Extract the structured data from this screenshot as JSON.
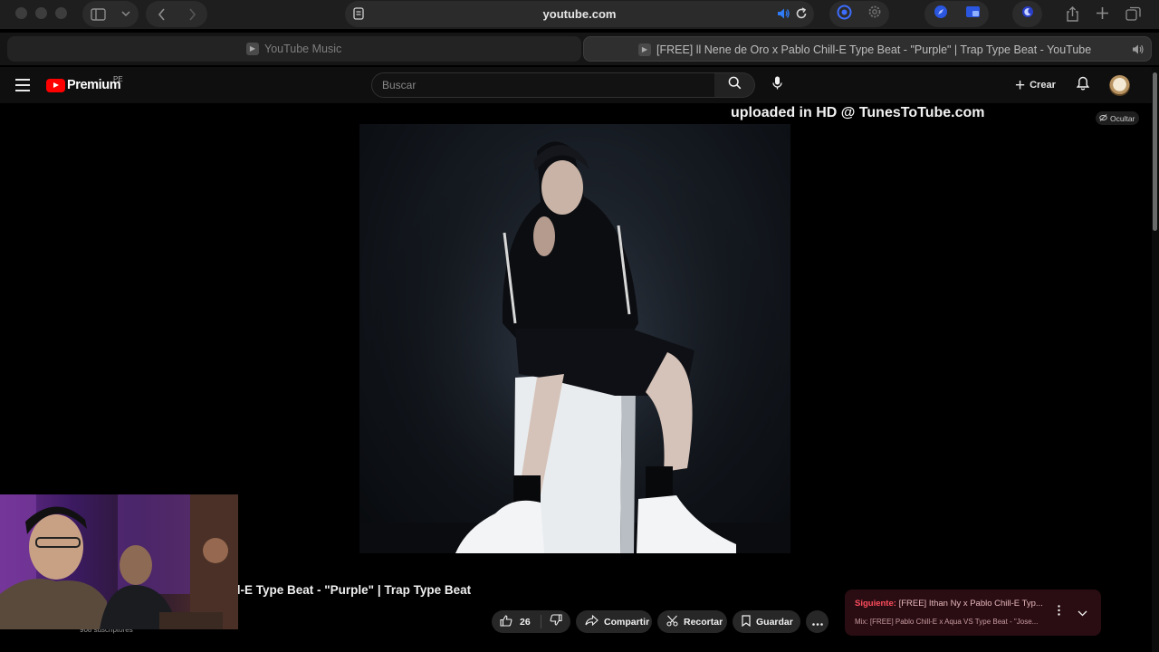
{
  "browser": {
    "url": "youtube.com",
    "tabs": [
      {
        "label": "YouTube Music",
        "active": false
      },
      {
        "label": "[FREE] ll Nene de Oro x Pablo Chill-E Type Beat - \"Purple\" | Trap Type Beat - YouTube",
        "active": true
      }
    ],
    "icons": [
      "sidebar-icon",
      "chevron-down-icon",
      "back-icon",
      "forward-icon",
      "reader-icon",
      "speaker-icon",
      "reload-icon",
      "share-icon",
      "new-tab-icon",
      "tab-overview-icon"
    ]
  },
  "masthead": {
    "logo": "Premium",
    "country_code": "PE",
    "search_placeholder": "Buscar",
    "create_label": "Crear"
  },
  "player": {
    "watermark": "uploaded in HD @ TunesToTube.com",
    "hide_label": "Ocultar"
  },
  "video": {
    "title": "ll-E Type Beat - \"Purple\" | Trap Type Beat",
    "subscribers": "908 suscriptores",
    "likes": "26",
    "share_label": "Compartir",
    "clip_label": "Recortar",
    "save_label": "Guardar"
  },
  "up_next": {
    "prefix": "Siguiente:",
    "title": "[FREE] Ithan Ny x Pablo Chill-E Typ...",
    "mix": "Mix: [FREE] Pablo Chill-E x Aqua VS Type Beat - \"Jose..."
  },
  "colors": {
    "accent": "#ff0000",
    "background": "#0f0f0f",
    "upnext_bg": "#2a0d12",
    "upnext_text": "#ff4d5e"
  }
}
